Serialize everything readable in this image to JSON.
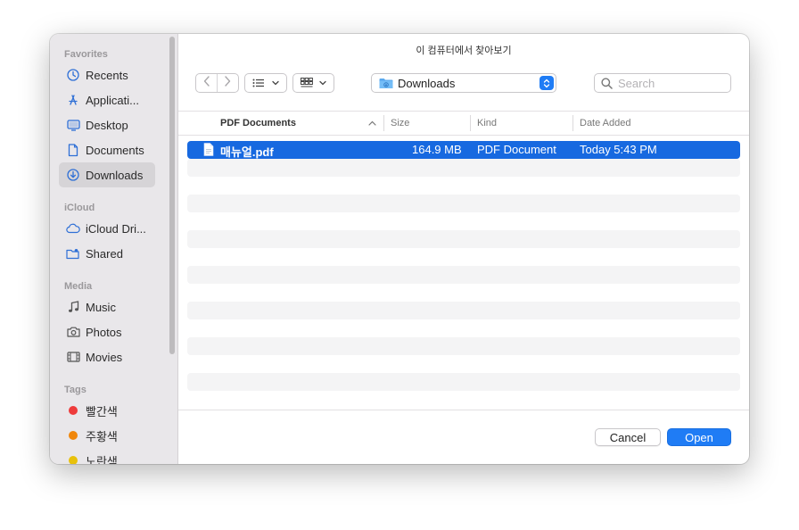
{
  "window": {
    "title": "이 컴퓨터에서 찾아보기"
  },
  "sidebar": {
    "sections": [
      {
        "label": "Favorites",
        "items": [
          {
            "label": "Recents",
            "icon": "clock-icon"
          },
          {
            "label": "Applicati...",
            "icon": "applications-icon"
          },
          {
            "label": "Desktop",
            "icon": "desktop-icon"
          },
          {
            "label": "Documents",
            "icon": "document-icon"
          },
          {
            "label": "Downloads",
            "icon": "download-icon",
            "selected": true
          }
        ]
      },
      {
        "label": "iCloud",
        "items": [
          {
            "label": "iCloud Dri...",
            "icon": "cloud-icon"
          },
          {
            "label": "Shared",
            "icon": "shared-folder-icon"
          }
        ]
      },
      {
        "label": "Media",
        "items": [
          {
            "label": "Music",
            "icon": "music-note-icon"
          },
          {
            "label": "Photos",
            "icon": "camera-icon"
          },
          {
            "label": "Movies",
            "icon": "film-icon"
          }
        ]
      },
      {
        "label": "Tags",
        "items": [
          {
            "label": "빨간색",
            "color": "#ee3b3b"
          },
          {
            "label": "주황색",
            "color": "#f0860a"
          },
          {
            "label": "노란색",
            "color": "#e8c10b"
          }
        ]
      }
    ]
  },
  "toolbar": {
    "location": "Downloads",
    "search_placeholder": "Search"
  },
  "columns": {
    "name": "PDF Documents",
    "size": "Size",
    "kind": "Kind",
    "date": "Date Added"
  },
  "files": [
    {
      "name": "매뉴얼.pdf",
      "size": "164.9 MB",
      "kind": "PDF Document",
      "date": "Today 5:43 PM",
      "selected": true
    }
  ],
  "buttons": {
    "cancel": "Cancel",
    "open": "Open"
  },
  "colors": {
    "accent": "#1f7cf5",
    "selection": "#1769e0",
    "sidebar_icon": "#2e6fd6"
  }
}
